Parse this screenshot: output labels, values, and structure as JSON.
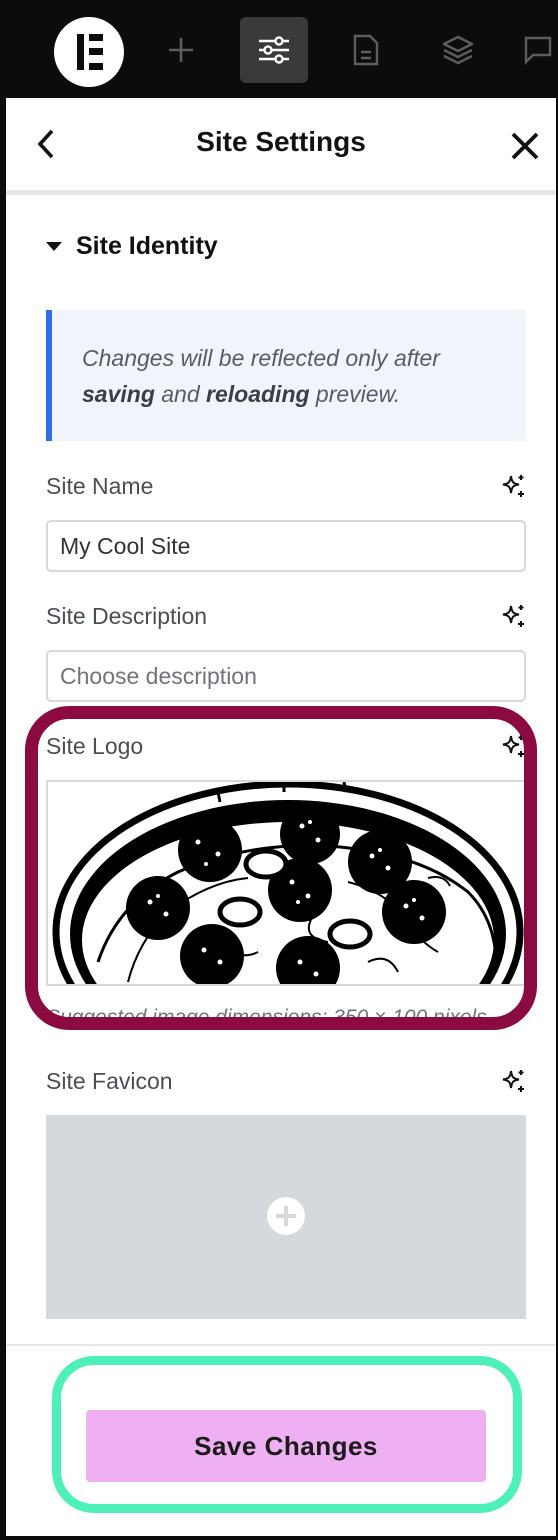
{
  "toolbar": {
    "logo_icon": "elementor-logo-icon",
    "add_icon": "plus-icon",
    "settings_icon": "sliders-icon",
    "page_icon": "document-icon",
    "layers_icon": "layers-icon",
    "comments_icon": "comment-icon",
    "active": "site-settings"
  },
  "header": {
    "title": "Site Settings",
    "back_icon": "chevron-left-icon",
    "close_icon": "close-icon"
  },
  "section": {
    "title": "Site Identity",
    "expanded": true
  },
  "notice": {
    "text_before": "Changes will be reflected only after ",
    "bold_1": "saving",
    "text_middle": " and ",
    "bold_2": "reloading",
    "text_after": " preview."
  },
  "fields": {
    "site_name": {
      "label": "Site Name",
      "value": "My Cool Site"
    },
    "site_description": {
      "label": "Site Description",
      "value": "",
      "placeholder": "Choose description"
    },
    "site_logo": {
      "label": "Site Logo",
      "hint": "Suggested image dimensions: 350 × 100 pixels."
    },
    "site_favicon": {
      "label": "Site Favicon"
    }
  },
  "ai_icon": "ai-sparkle-icon",
  "footer": {
    "save_label": "Save Changes"
  },
  "colors": {
    "accent_save": "#eeb0f3",
    "highlight_logo": "#8b0a3f",
    "highlight_save": "#4ef0b9",
    "notice_border": "#2f6ee3"
  }
}
